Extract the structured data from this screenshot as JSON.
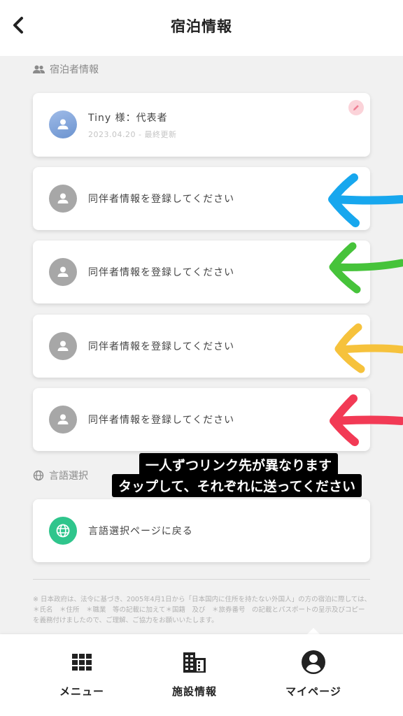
{
  "header": {
    "title": "宿泊情報",
    "back_icon": "chevron-left-icon"
  },
  "guests_section": {
    "label": "宿泊者情報",
    "icon": "people-icon"
  },
  "representative": {
    "name": "Tiny 様：代表者",
    "updated": "2023.04.20 - 最終更新",
    "edit_icon": "pencil-icon"
  },
  "companions": [
    {
      "label": "同伴者情報を登録してください",
      "arrow_color": "#17a7ee"
    },
    {
      "label": "同伴者情報を登録してください",
      "arrow_color": "#46c33a"
    },
    {
      "label": "同伴者情報を登録してください",
      "arrow_color": "#f6c23c"
    },
    {
      "label": "同伴者情報を登録してください",
      "arrow_color": "#f23a55"
    }
  ],
  "language_section": {
    "label": "言語選択",
    "icon": "globe-icon",
    "button": "言語選択ページに戻る"
  },
  "annotation": {
    "line1": "一人ずつリンク先が異なります",
    "line2": "タップして、それぞれに送ってください"
  },
  "notice": "※ 日本政府は、法令に基づき、2005年4月1日から「日本国内に住所を持たない外国人」の方の宿泊に際しては、＊氏名　＊住所　＊職業　等の記載に加えて＊国籍　及び　＊旅券番号　の記載とパスポートの呈示及びコピーを義務付けましたので、ご理解、ご協力をお願いいたします。",
  "bottom_nav": [
    {
      "label": "メニュー",
      "icon": "grid-icon"
    },
    {
      "label": "施設情報",
      "icon": "building-icon"
    },
    {
      "label": "マイページ",
      "icon": "account-circle-icon"
    }
  ]
}
